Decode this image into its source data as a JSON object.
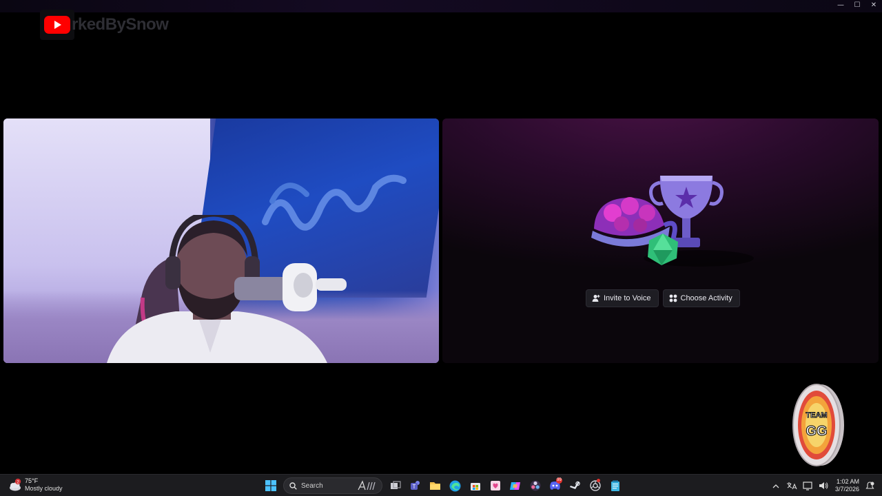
{
  "window": {
    "controls": {
      "minimize": "—",
      "maximize": "☐",
      "close": "✕"
    }
  },
  "watermark": {
    "text": "rkedBySnow",
    "icon": "youtube-icon"
  },
  "activity": {
    "invite_label": "Invite to Voice",
    "choose_label": "Choose Activity",
    "colors": {
      "button_bg": "#1e1d23",
      "accent": "#a43ad8"
    }
  },
  "badge": {
    "text_top": "TEAM",
    "text_bottom": "GG"
  },
  "taskbar": {
    "weather": {
      "temp": "75°F",
      "desc": "Mostly cloudy",
      "alert_count": "2"
    },
    "search_label": "Search",
    "pinned": [
      {
        "name": "task-view-icon"
      },
      {
        "name": "teams-icon"
      },
      {
        "name": "file-explorer-icon"
      },
      {
        "name": "edge-icon"
      },
      {
        "name": "store-icon"
      },
      {
        "name": "photos-icon"
      },
      {
        "name": "copilot-icon"
      },
      {
        "name": "obs-icon"
      },
      {
        "name": "discord-icon",
        "badge": "99"
      },
      {
        "name": "steam-icon"
      },
      {
        "name": "chrome-icon"
      },
      {
        "name": "notepad-icon"
      }
    ],
    "tray": {
      "time": "1:02 AM",
      "date": "3/7/2026"
    }
  }
}
